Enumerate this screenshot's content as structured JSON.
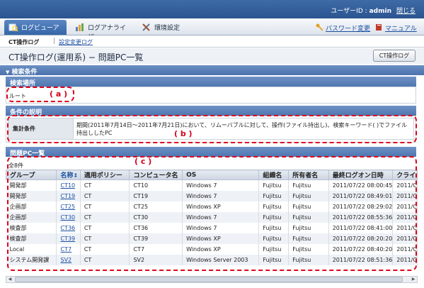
{
  "header": {
    "user_label": "ユーザーID :",
    "user_id": "admin",
    "logout": "閉じる"
  },
  "nav": {
    "tabs": [
      {
        "label": "ログビューア"
      },
      {
        "label": "ログアナライザ"
      },
      {
        "label": "環境設定"
      }
    ],
    "links": [
      {
        "label": "パスワード変更"
      },
      {
        "label": "マニュアル"
      }
    ]
  },
  "subnav": {
    "current": "CT操作ログ",
    "separator": "|",
    "link": "設定変更ログ"
  },
  "page": {
    "title": "CT操作ログ(運用系) − 問題PC一覧",
    "button": "CT操作ログ"
  },
  "search": {
    "section_title": "検索条件",
    "location_header": "検索場所",
    "location_value": "ルート"
  },
  "conditions": {
    "header": "条件の説明",
    "label": "集計条件",
    "text": "期間(2011年7月14日〜2011年7月21日)において、リムーバブルに対して、操作(ファイル持出し)、検索キーワード( )でファイル持出ししたPC"
  },
  "problem_list": {
    "header": "問題PC一覧",
    "count": "全8件",
    "columns": [
      "グループ",
      "名称",
      "適用ポリシー",
      "コンピュータ名",
      "OS",
      "組織名",
      "所有者名",
      "最終ログオン日時",
      "クライ"
    ],
    "sort_indicator": "⇕",
    "rows": [
      [
        "開発部",
        "CT10",
        "CT",
        "CT10",
        "Windows 7",
        "Fujitsu",
        "Fujitsu",
        "2011/07/22 08:00:45",
        "2011/C"
      ],
      [
        "開発部",
        "CT19",
        "CT",
        "CT19",
        "Windows 7",
        "Fujitsu",
        "Fujitsu",
        "2011/07/22 08:49:01",
        "2011/C"
      ],
      [
        "企画部",
        "CT25",
        "CT",
        "CT25",
        "Windows XP",
        "Fujitsu",
        "Fujitsu",
        "2011/07/22 08:29:02",
        "2011/C"
      ],
      [
        "企画部",
        "CT30",
        "CT",
        "CT30",
        "Windows 7",
        "Fujitsu",
        "Fujitsu",
        "2011/07/22 08:55:36",
        "2011/C"
      ],
      [
        "検査部",
        "CT36",
        "CT",
        "CT36",
        "Windows 7",
        "Fujitsu",
        "Fujitsu",
        "2011/07/22 08:41:00",
        "2011/C"
      ],
      [
        "検査部",
        "CT39",
        "CT",
        "CT39",
        "Windows XP",
        "Fujitsu",
        "Fujitsu",
        "2011/07/22 08:20:20",
        "2011/C"
      ],
      [
        "Local",
        "CT7",
        "CT",
        "CT7",
        "Windows XP",
        "Fujitsu",
        "Fujitsu",
        "2011/07/22 08:40:20",
        "2011/C"
      ],
      [
        "システム開発課",
        "SV2",
        "CT",
        "SV2",
        "Windows Server 2003",
        "Fujitsu",
        "Fujitsu",
        "2011/07/22 08:51:36",
        "2011/C"
      ]
    ]
  },
  "markers": {
    "a": "( a )",
    "b": "( b )",
    "c": "( c )"
  },
  "colors": {
    "header_blue": "#2b5590",
    "section_blue": "#4a72ad",
    "annotation_red": "#e0001b",
    "link_blue": "#1a4fa0"
  }
}
